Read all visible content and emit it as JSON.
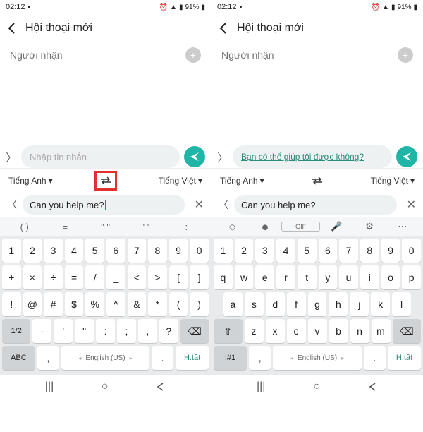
{
  "status": {
    "time": "02:12",
    "battery": "91%"
  },
  "header": {
    "title": "Hội thoại mới"
  },
  "recipient": {
    "placeholder": "Người nhận"
  },
  "compose": {
    "placeholder": "Nhập tin nhắn",
    "translated_text": "Bạn có thể giúp tôi được không?"
  },
  "translate": {
    "lang_from": "Tiếng Anh",
    "lang_to": "Tiếng Việt"
  },
  "input": {
    "text": "Can you help me?",
    "clear": "✕"
  },
  "toolbar_sym": [
    "( )",
    "=",
    "\"  \"",
    "'  '",
    ":"
  ],
  "toolbar_emoji_icons": [
    "emoji-icon",
    "sticker-icon",
    "gif-icon",
    "voice-icon",
    "settings-icon",
    "expand-icon"
  ],
  "kb_sym": {
    "r1": [
      "1",
      "2",
      "3",
      "4",
      "5",
      "6",
      "7",
      "8",
      "9",
      "0"
    ],
    "r2": [
      "+",
      "×",
      "÷",
      "=",
      "/",
      "_",
      "<",
      ">",
      "[",
      "]"
    ],
    "r3": [
      "!",
      "@",
      "#",
      "$",
      "%",
      "^",
      "&",
      "*",
      "(",
      ")"
    ],
    "r4_left": "1/2",
    "r4": [
      "-",
      "'",
      "\"",
      ":",
      ";",
      ",",
      "?"
    ],
    "r4_bksp": "⌫",
    "r5_left": "ABC",
    "r5_comma": ",",
    "r5_space": "English (US)",
    "r5_dot": ".",
    "r5_right": "H.tất"
  },
  "kb_qw": {
    "r1": [
      "1",
      "2",
      "3",
      "4",
      "5",
      "6",
      "7",
      "8",
      "9",
      "0"
    ],
    "r2": [
      "q",
      "w",
      "e",
      "r",
      "t",
      "y",
      "u",
      "i",
      "o",
      "p"
    ],
    "r3": [
      "a",
      "s",
      "d",
      "f",
      "g",
      "h",
      "j",
      "k",
      "l"
    ],
    "r4_shift": "⇧",
    "r4": [
      "z",
      "x",
      "c",
      "v",
      "b",
      "n",
      "m"
    ],
    "r4_bksp": "⌫",
    "r5_left": "!#1",
    "r5_comma": ",",
    "r5_space": "English (US)",
    "r5_dot": ".",
    "r5_right": "H.tất"
  }
}
